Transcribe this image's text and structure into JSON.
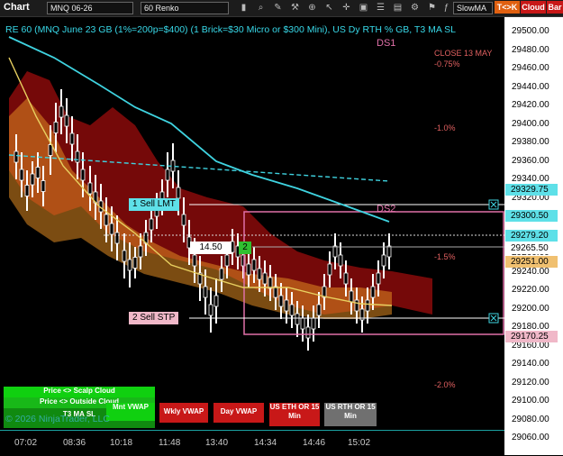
{
  "toolbar": {
    "chart_label": "Chart",
    "instrument": "MNQ 06-26",
    "bar_type": "60 Renko",
    "indicator_select": "SlowMA",
    "tk_button": "T<>K",
    "cloud_button": "Cloud",
    "bar_button": "Bar"
  },
  "header": {
    "title": "RE 60 (MNQ June 23 GB (1%=200p=$400) (1 Brick=$30 Micro or $300 Mini), US Dy RTH % GB, T3 MA SL",
    "ds1": "DS1",
    "ds2": "DS2",
    "close_label": "CLOSE 13 MAY",
    "pct_neg075": "-0.75%",
    "pct_neg1": "-1.0%",
    "pct_neg15": "-1.5%",
    "pct_neg2": "-2.0%"
  },
  "orders": {
    "sell_lmt": "1 Sell LMT",
    "sell_stp": "2 Sell STP",
    "position_price": "14.50",
    "position_qty": "2"
  },
  "legend": {
    "scalp": "Price <> Scalp Cloud",
    "outside": "Price <> Outside Cloud",
    "t3": "T3 MA SL",
    "mnt": "Mnt VWAP",
    "wkly": "Wkly VWAP",
    "day": "Day VWAP",
    "us_eth": "US ETH OR 15 Min",
    "us_rth": "US RTH OR 15 Min",
    "copyright": "© 2026 NinjaTrader, LLC"
  },
  "price_axis": {
    "ticks": [
      "29500.00",
      "29480.00",
      "29460.00",
      "29440.00",
      "29420.00",
      "29400.00",
      "29380.00",
      "29360.00",
      "29340.00",
      "29320.00",
      "29300.00",
      "29280.00",
      "29260.00",
      "29240.00",
      "29220.00",
      "29200.00",
      "29180.00",
      "29160.00",
      "29140.00",
      "29120.00",
      "29100.00",
      "29080.00",
      "29060.00"
    ],
    "tags": [
      {
        "value": "29329.75",
        "color": "#5ee0e8"
      },
      {
        "value": "29300.50",
        "color": "#5ee0e8"
      },
      {
        "value": "29279.20",
        "color": "#5ee0e8"
      },
      {
        "value": "29265.50",
        "color": "#ffffff"
      },
      {
        "value": "29251.00",
        "color": "#f0c070"
      },
      {
        "value": "29170.25",
        "color": "#f0b8c8"
      }
    ]
  },
  "time_axis": {
    "ticks": [
      "07:02",
      "08:36",
      "10:18",
      "11:48",
      "13:40",
      "14:34",
      "14:46",
      "15:02"
    ]
  },
  "colors": {
    "cyan": "#3fd3e0",
    "orange": "#f0a030",
    "red_cloud": "#b01010",
    "yellow_line": "#e8d060",
    "white_brick": "#ffffff"
  }
}
